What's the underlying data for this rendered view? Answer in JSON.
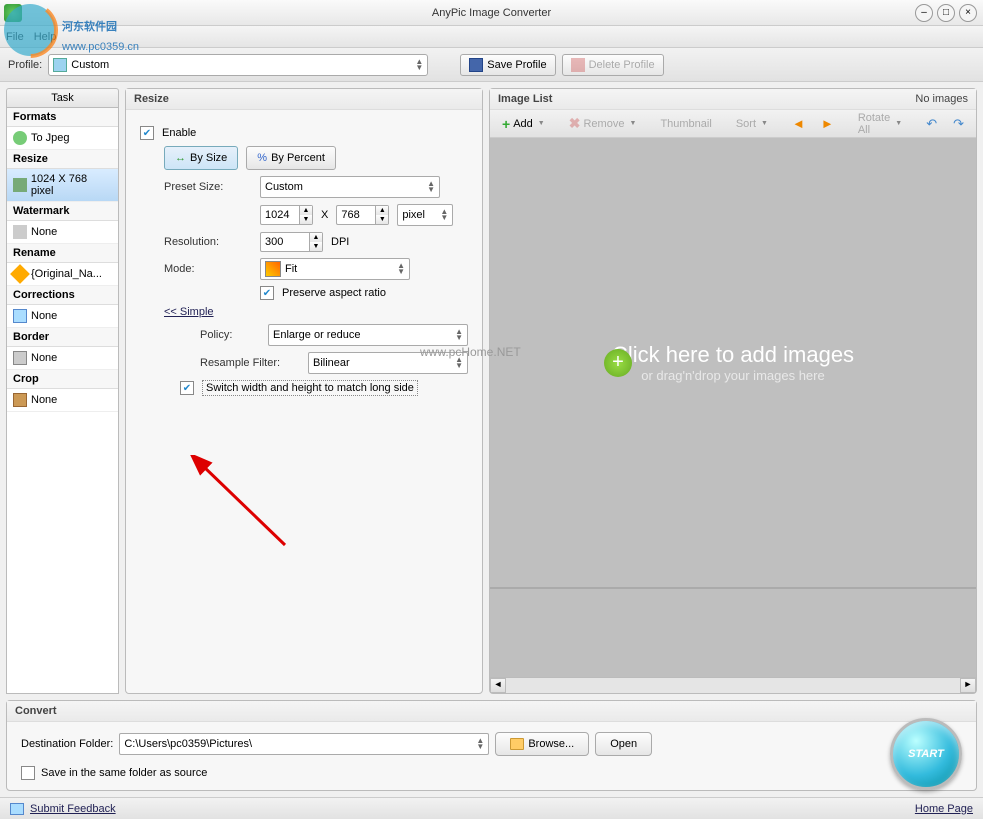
{
  "window": {
    "title": "AnyPic Image Converter"
  },
  "menu": {
    "file": "File",
    "help": "Help"
  },
  "toolbar": {
    "profile_label": "Profile:",
    "profile_value": "Custom",
    "save_profile": "Save Profile",
    "delete_profile": "Delete Profile"
  },
  "task": {
    "header": "Task",
    "formats": {
      "title": "Formats",
      "item": "To Jpeg"
    },
    "resize": {
      "title": "Resize",
      "item": "1024 X 768 pixel"
    },
    "watermark": {
      "title": "Watermark",
      "item": "None"
    },
    "rename": {
      "title": "Rename",
      "item": "{Original_Na..."
    },
    "corrections": {
      "title": "Corrections",
      "item": "None"
    },
    "border": {
      "title": "Border",
      "item": "None"
    },
    "crop": {
      "title": "Crop",
      "item": "None"
    }
  },
  "resize": {
    "title": "Resize",
    "enable": "Enable",
    "by_size": "By Size",
    "by_percent": "By Percent",
    "preset_label": "Preset Size:",
    "preset_value": "Custom",
    "width": "1024",
    "x": "X",
    "height": "768",
    "unit": "pixel",
    "resolution_label": "Resolution:",
    "resolution_value": "300",
    "dpi": "DPI",
    "mode_label": "Mode:",
    "mode_value": "Fit",
    "preserve": "Preserve aspect ratio",
    "simple": "<< Simple",
    "policy_label": "Policy:",
    "policy_value": "Enlarge or reduce",
    "filter_label": "Resample Filter:",
    "filter_value": "Bilinear",
    "switch": "Switch width and height to match long side"
  },
  "imagelist": {
    "title": "Image List",
    "no_images": "No images",
    "add": "Add",
    "remove": "Remove",
    "thumbnail": "Thumbnail",
    "sort": "Sort",
    "rotate_all": "Rotate All",
    "drop_big": "Click here  to add images",
    "drop_small": "or drag'n'drop your images here"
  },
  "convert": {
    "title": "Convert",
    "dest_label": "Destination Folder:",
    "dest_value": "C:\\Users\\pc0359\\Pictures\\",
    "browse": "Browse...",
    "open": "Open",
    "same_folder": "Save in the same folder as source",
    "start": "START"
  },
  "status": {
    "feedback": "Submit Feedback",
    "home": "Home Page"
  },
  "overlay": {
    "site": "河东软件园",
    "url": "www.pc0359.cn",
    "wm": "www.pcHome.NET"
  }
}
